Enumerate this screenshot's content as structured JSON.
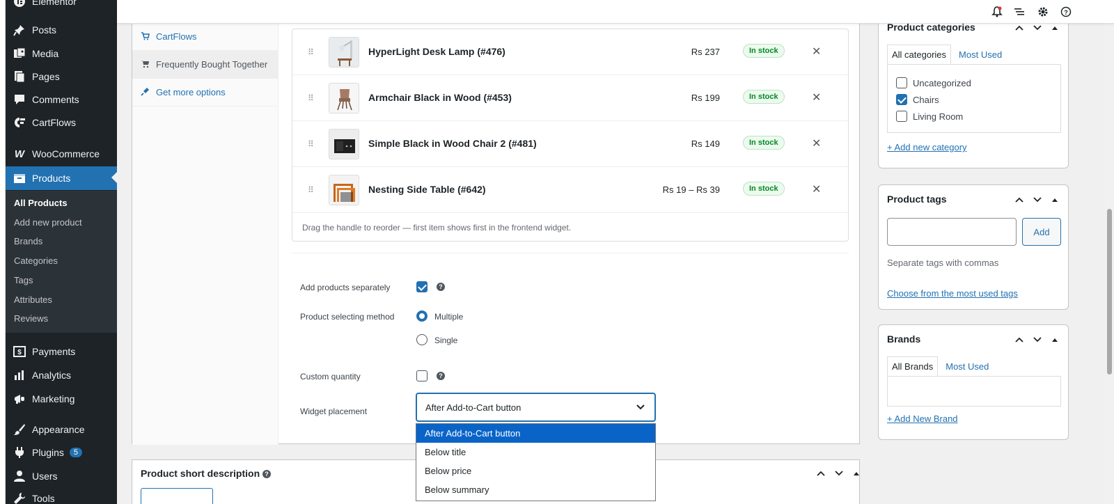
{
  "sidebar": {
    "items": [
      {
        "label": "Elementor"
      },
      {
        "label": "Posts"
      },
      {
        "label": "Media"
      },
      {
        "label": "Pages"
      },
      {
        "label": "Comments"
      },
      {
        "label": "CartFlows"
      },
      {
        "label": "WooCommerce"
      },
      {
        "label": "Products"
      },
      {
        "label": "Payments"
      },
      {
        "label": "Analytics"
      },
      {
        "label": "Marketing"
      },
      {
        "label": "Appearance"
      },
      {
        "label": "Plugins",
        "badge": "5"
      },
      {
        "label": "Users"
      },
      {
        "label": "Tools"
      }
    ],
    "submenu": [
      {
        "label": "All Products"
      },
      {
        "label": "Add new product"
      },
      {
        "label": "Brands"
      },
      {
        "label": "Categories"
      },
      {
        "label": "Tags"
      },
      {
        "label": "Attributes"
      },
      {
        "label": "Reviews"
      }
    ]
  },
  "product_tabs": [
    {
      "label": "CartFlows"
    },
    {
      "label": "Frequently Bought Together"
    },
    {
      "label": "Get more options"
    }
  ],
  "products": [
    {
      "name": "HyperLight Desk Lamp (#476)",
      "price": "Rs 237",
      "stock": "In stock"
    },
    {
      "name": "Armchair Black in Wood (#453)",
      "price": "Rs 199",
      "stock": "In stock"
    },
    {
      "name": "Simple Black in Wood Chair 2 (#481)",
      "price": "Rs 149",
      "stock": "In stock"
    },
    {
      "name": "Nesting Side Table (#642)",
      "price": "Rs 19 – Rs 39",
      "stock": "In stock"
    }
  ],
  "table_note": "Drag the handle to reorder — first item shows first in the frontend widget.",
  "settings": {
    "add_separately_label": "Add products separately",
    "add_separately_checked": true,
    "selecting_method_label": "Product selecting method",
    "method_multiple": "Multiple",
    "method_single": "Single",
    "method_selected": "Multiple",
    "custom_qty_label": "Custom quantity",
    "custom_qty_checked": false,
    "placement_label": "Widget placement",
    "placement_value": "After Add-to-Cart button",
    "placement_options": [
      "After Add-to-Cart button",
      "Below title",
      "Below price",
      "Below summary"
    ]
  },
  "short_description": {
    "title": "Product short description"
  },
  "categories": {
    "title": "Product categories",
    "tab_all": "All categories",
    "tab_most": "Most Used",
    "items": [
      {
        "label": "Uncategorized",
        "checked": false
      },
      {
        "label": "Chairs",
        "checked": true
      },
      {
        "label": "Living Room",
        "checked": false
      }
    ],
    "add_link": "+ Add new category"
  },
  "tags": {
    "title": "Product tags",
    "add_button": "Add",
    "hint": "Separate tags with commas",
    "choose_link": "Choose from the most used tags"
  },
  "brands": {
    "title": "Brands",
    "tab_all": "All Brands",
    "tab_most": "Most Used",
    "add_link": "+ Add New Brand"
  },
  "colors": {
    "accent": "#2271b1",
    "sidebar": "#1d2327",
    "stock_green": "#008a20"
  }
}
